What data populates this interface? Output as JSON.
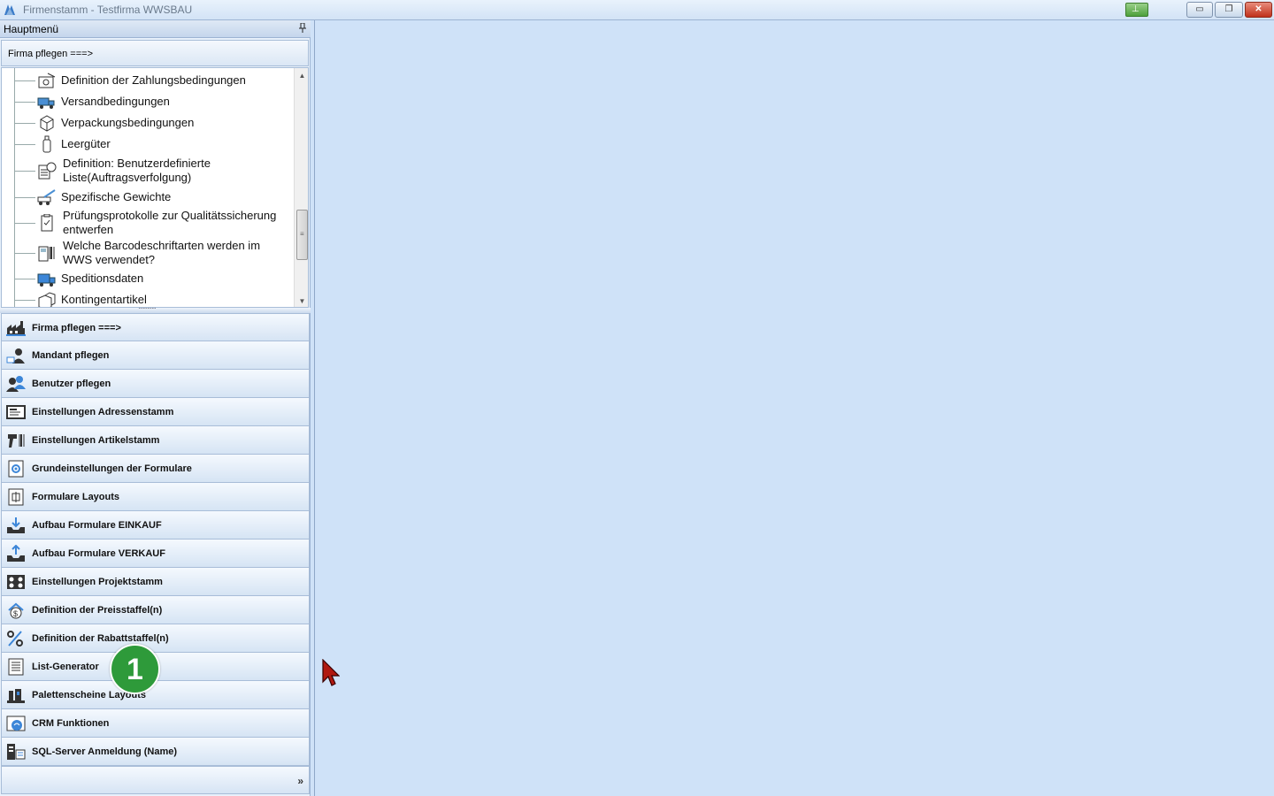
{
  "window": {
    "title": "Firmenstamm - Testfirma WWSBAU",
    "minimize_glyph": "▭",
    "maximize_glyph": "❐",
    "close_glyph": "✕"
  },
  "sidebar": {
    "header": "Hauptmenü",
    "pin_glyph": "📌",
    "section_header": "Firma pflegen   ===>",
    "tree_items": [
      {
        "label": "Definition der Zahlungsbedingungen",
        "icon": "payment-terms-icon"
      },
      {
        "label": "Versandbedingungen",
        "icon": "shipping-truck-icon"
      },
      {
        "label": "Verpackungsbedingungen",
        "icon": "package-box-icon"
      },
      {
        "label": "Leergüter",
        "icon": "bottle-icon"
      },
      {
        "label_line1": "Definition: Benutzerdefinierte",
        "label_line2": "Liste(Auftragsverfolgung)",
        "icon": "custom-list-clock-icon"
      },
      {
        "label": "Spezifische Gewichte",
        "icon": "crane-truck-icon"
      },
      {
        "label_line1": "Prüfungsprotokolle zur Qualitätssicherung",
        "label_line2": "entwerfen",
        "icon": "checklist-clipboard-icon"
      },
      {
        "label_line1": "Welche Barcodeschriftarten werden im",
        "label_line2": "WWS verwendet?",
        "icon": "barcode-scanner-icon"
      },
      {
        "label": "Speditionsdaten",
        "icon": "delivery-truck-icon"
      },
      {
        "label": "Kontingentartikel",
        "icon": "boxes-icon"
      }
    ],
    "nav_buttons": [
      {
        "label": "Firma pflegen   ===>",
        "icon": "factory-icon"
      },
      {
        "label": "Mandant pflegen",
        "icon": "client-user-icon"
      },
      {
        "label": "Benutzer pflegen",
        "icon": "users-icon"
      },
      {
        "label": "Einstellungen Adressenstamm",
        "icon": "address-card-icon"
      },
      {
        "label": "Einstellungen Artikelstamm",
        "icon": "barcode-gun-icon"
      },
      {
        "label": "Grundeinstellungen der Formulare",
        "icon": "form-settings-icon"
      },
      {
        "label": "Formulare Layouts",
        "icon": "form-layout-icon"
      },
      {
        "label": "Aufbau Formulare EINKAUF",
        "icon": "inbox-download-icon"
      },
      {
        "label": "Aufbau Formulare VERKAUF",
        "icon": "outbox-upload-icon"
      },
      {
        "label": "Einstellungen Projektstamm",
        "icon": "project-icon"
      },
      {
        "label": "Definition der Preisstaffel(n)",
        "icon": "price-scale-icon"
      },
      {
        "label": "Definition der Rabattstaffel(n)",
        "icon": "discount-percent-icon"
      },
      {
        "label": "List-Generator",
        "icon": "list-document-icon"
      },
      {
        "label": "Palettenscheine Layouts",
        "icon": "pallet-icon"
      },
      {
        "label": "CRM Funktionen",
        "icon": "crm-icon"
      },
      {
        "label": "SQL-Server Anmeldung (Name)",
        "icon": "sql-server-icon"
      }
    ],
    "overflow_glyph": "»"
  },
  "step_badge": "1",
  "colors": {
    "main_bg": "#cfe2f8",
    "badge": "#2e9a3a",
    "close_button": "#c0301b"
  }
}
